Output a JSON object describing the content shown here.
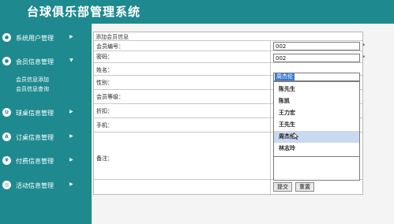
{
  "app": {
    "title": "台球俱乐部管理系统"
  },
  "sidebar": {
    "items": [
      {
        "label": "系统用户管理",
        "icon": "user-icon"
      },
      {
        "label": "会员信息管理",
        "icon": "members-icon",
        "expanded": true,
        "children": [
          "会员信息添加",
          "会员信息查询"
        ]
      },
      {
        "label": "球桌信息管理",
        "icon": "table-icon"
      },
      {
        "label": "订桌信息管理",
        "icon": "app-icon"
      },
      {
        "label": "付费信息管理",
        "icon": "payment-icon"
      },
      {
        "label": "活动信息管理",
        "icon": "activity-icon"
      }
    ]
  },
  "form": {
    "caption": "添加会员信息",
    "fields": {
      "member_no": {
        "label": "会员编号：",
        "value": "002",
        "required_mark": "*"
      },
      "password": {
        "label": "密码：",
        "value": "002",
        "required_mark": "*"
      },
      "name": {
        "label": "姓名：",
        "selected": "周杰伦"
      },
      "gender": {
        "label": "性别："
      },
      "level": {
        "label": "会员等级："
      },
      "discount": {
        "label": "折扣："
      },
      "phone": {
        "label": "手机："
      },
      "remark": {
        "label": "备注："
      }
    },
    "name_options": [
      "陈先生",
      "陈凯",
      "王力宏",
      "王先生",
      "周杰伦",
      "林志玲"
    ],
    "hover_option_index": 4,
    "buttons": {
      "submit": "提交",
      "reset": "重置"
    }
  },
  "colors": {
    "accent": "#1e8a8f",
    "selection": "#3b7bd6",
    "hover": "#c8d9f0"
  }
}
